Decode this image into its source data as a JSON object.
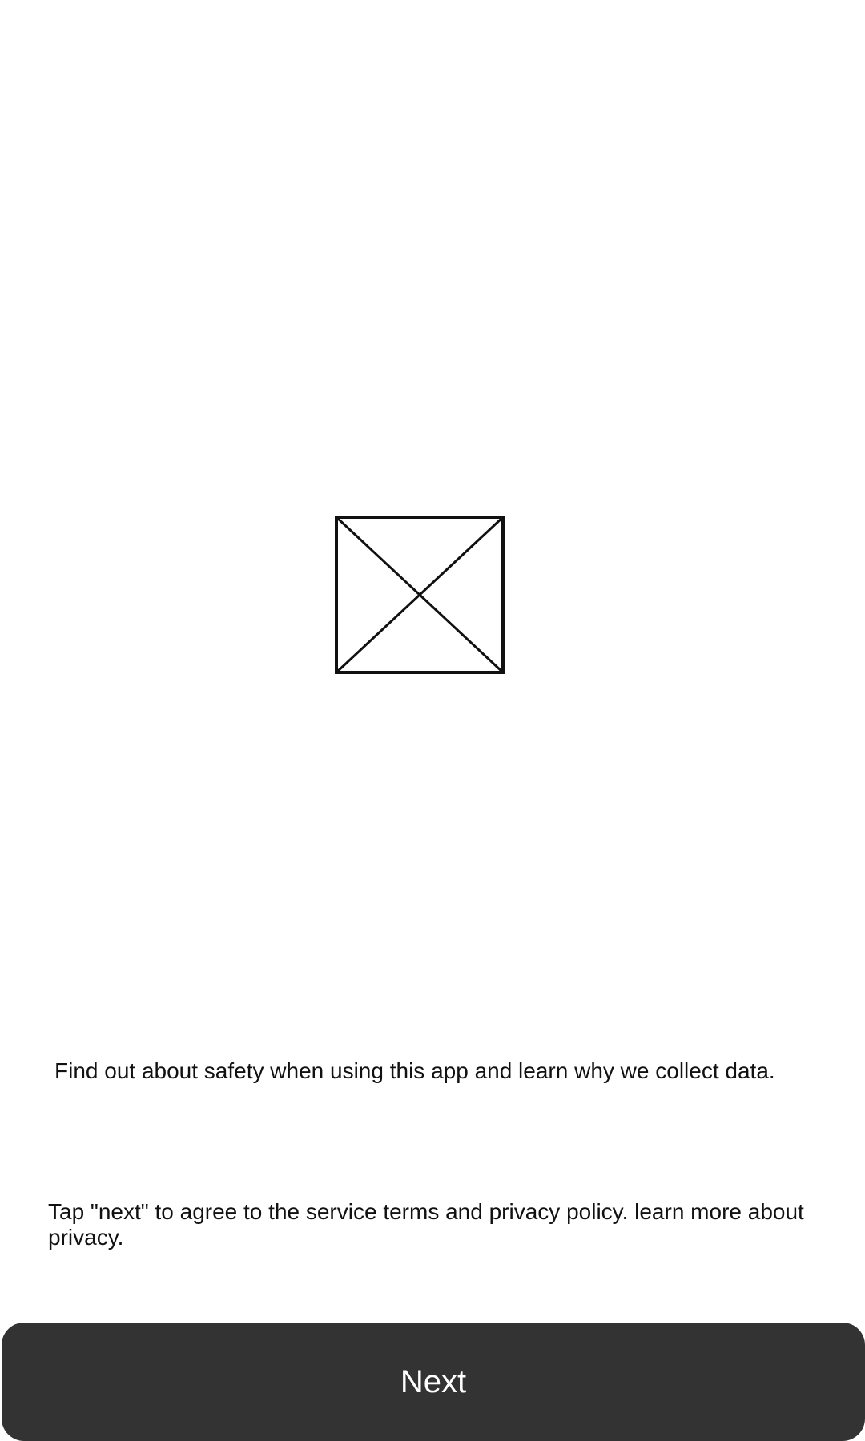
{
  "onboarding": {
    "image_icon": "image-placeholder-icon",
    "safety_text": "Find out about safety when using this app and learn why we collect data.",
    "terms_text": "Tap \"next\" to agree to the service terms and privacy policy. learn more about privacy.",
    "next_label": "Next"
  },
  "colors": {
    "background": "#ffffff",
    "text": "#111111",
    "button_background": "#333333",
    "button_text": "#ffffff"
  }
}
